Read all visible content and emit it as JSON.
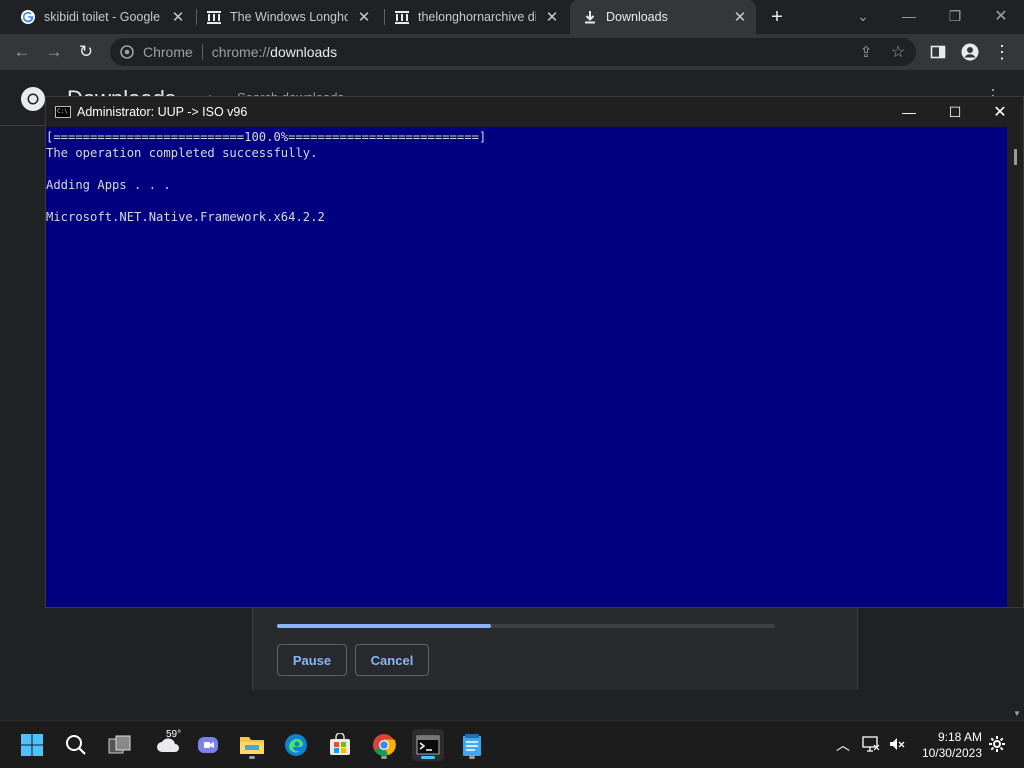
{
  "browser": {
    "tabs": [
      {
        "title": "skibidi toilet - Google Search",
        "icon": "google-g-icon",
        "active": false
      },
      {
        "title": "The Windows Longhorn Archive",
        "icon": "archive-building-icon",
        "active": false
      },
      {
        "title": "thelonghornarchive directory",
        "icon": "archive-building-icon",
        "active": false
      },
      {
        "title": "Downloads",
        "icon": "download-arrow-icon",
        "active": true
      }
    ],
    "new_tab_symbol": "+",
    "address_bar": {
      "chip_label": "Chrome",
      "url_scheme": "chrome://",
      "url_host": "downloads"
    }
  },
  "downloads_page": {
    "title": "Downloads",
    "search_placeholder": "Search downloads",
    "progress_fraction": 0.43,
    "pause_label": "Pause",
    "cancel_label": "Cancel"
  },
  "console": {
    "title": "Administrator:  UUP -> ISO v96",
    "lines": [
      "[==========================100.0%==========================]",
      "The operation completed successfully.",
      "",
      "Adding Apps . . .",
      "",
      "Microsoft.NET.Native.Framework.x64.2.2"
    ]
  },
  "taskbar": {
    "weather_temp": "59°",
    "apps": [
      "start-icon",
      "search-icon",
      "task-view-icon",
      "weather-icon",
      "teams-chat-icon",
      "file-explorer-icon",
      "edge-icon",
      "store-icon",
      "chrome-icon",
      "terminal-icon",
      "notepad-icon"
    ],
    "clock_time": "9:18 AM",
    "clock_date": "10/30/2023"
  },
  "colors": {
    "console_background": "#000080",
    "console_text": "#d8d8d8",
    "accent": "#8ab4f8",
    "taskbar_active": "#4cc2ff"
  }
}
